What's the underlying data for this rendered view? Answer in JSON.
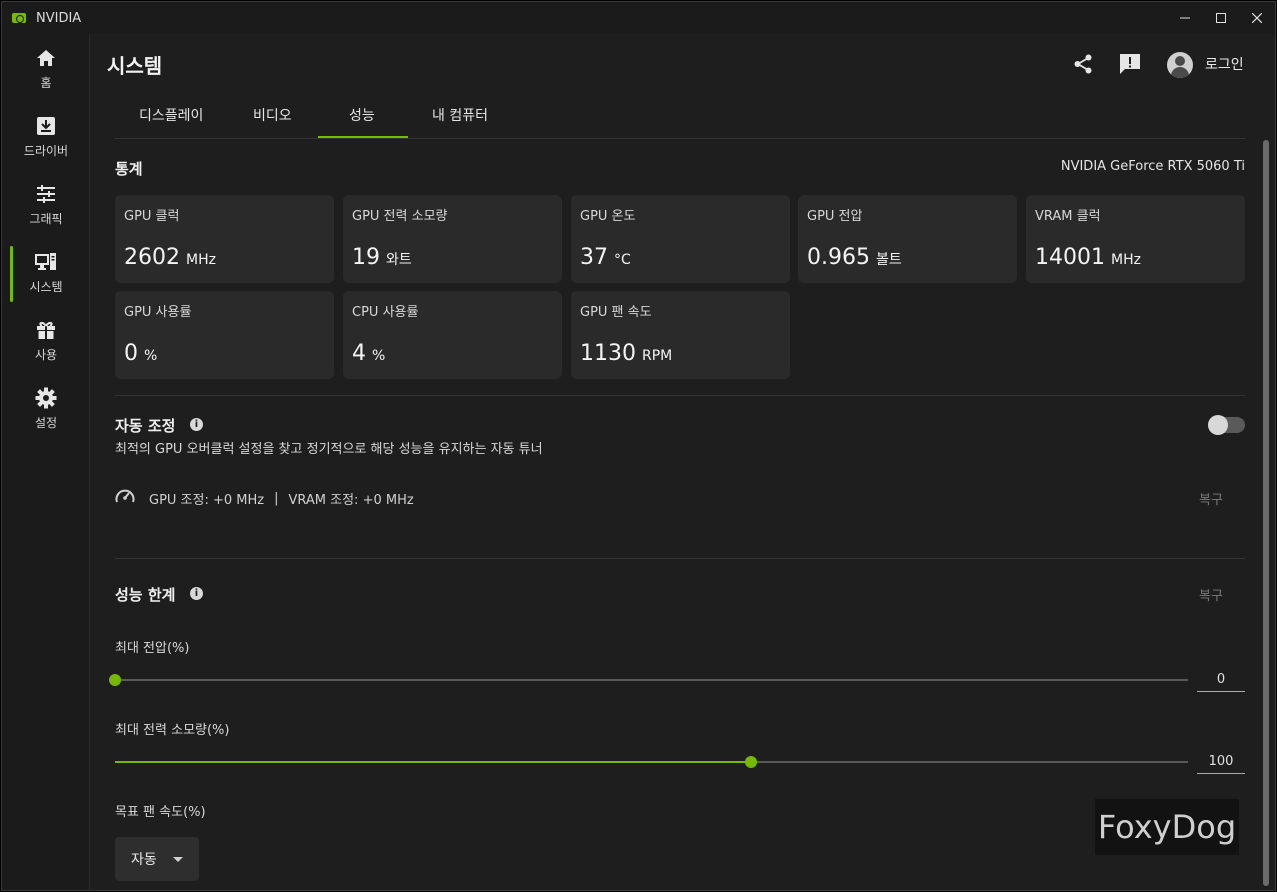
{
  "window": {
    "title": "NVIDIA",
    "brand_color": "#76b900"
  },
  "sidebar": {
    "items": [
      {
        "label": "홈",
        "icon": "home-icon"
      },
      {
        "label": "드라이버",
        "icon": "download-icon"
      },
      {
        "label": "그래픽",
        "icon": "sliders-icon"
      },
      {
        "label": "시스템",
        "icon": "system-icon",
        "active": true
      },
      {
        "label": "사용",
        "icon": "gift-icon"
      },
      {
        "label": "설정",
        "icon": "gear-icon"
      }
    ]
  },
  "header": {
    "title": "시스템",
    "login_label": "로그인"
  },
  "tabs": [
    {
      "label": "디스플레이"
    },
    {
      "label": "비디오"
    },
    {
      "label": "성능",
      "active": true
    },
    {
      "label": "내 컴퓨터"
    }
  ],
  "stats": {
    "title": "통계",
    "gpu_name": "NVIDIA GeForce RTX 5060 Ti",
    "cards": [
      {
        "label": "GPU 클럭",
        "value": "2602",
        "unit": "MHz"
      },
      {
        "label": "GPU 전력 소모량",
        "value": "19",
        "unit": "와트"
      },
      {
        "label": "GPU 온도",
        "value": "37",
        "unit": "°C"
      },
      {
        "label": "GPU 전압",
        "value": "0.965",
        "unit": "볼트"
      },
      {
        "label": "VRAM 클럭",
        "value": "14001",
        "unit": "MHz"
      },
      {
        "label": "GPU 사용률",
        "value": "0",
        "unit": "%"
      },
      {
        "label": "CPU 사용률",
        "value": "4",
        "unit": "%"
      },
      {
        "label": "GPU 팬 속도",
        "value": "1130",
        "unit": "RPM"
      }
    ]
  },
  "auto_tune": {
    "title": "자동 조정",
    "description": "최적의 GPU 오버클럭 설정을 찾고 정기적으로 해당 성능을 유지하는 자동 튜너",
    "enabled": false,
    "gpu_tune": "GPU 조정: +0 MHz",
    "separator": "|",
    "vram_tune": "VRAM 조정: +0 MHz",
    "reset_label": "복구"
  },
  "limits": {
    "title": "성능 한계",
    "reset_label": "복구",
    "max_voltage": {
      "label": "최대 전압(%)",
      "value": "0",
      "fraction": 0.0
    },
    "max_power": {
      "label": "최대 전력 소모량(%)",
      "value": "100",
      "fraction": 0.593
    },
    "fan_target": {
      "label": "목표 팬 속도(%)",
      "value": "자동"
    }
  },
  "watermark": "FoxyDog"
}
